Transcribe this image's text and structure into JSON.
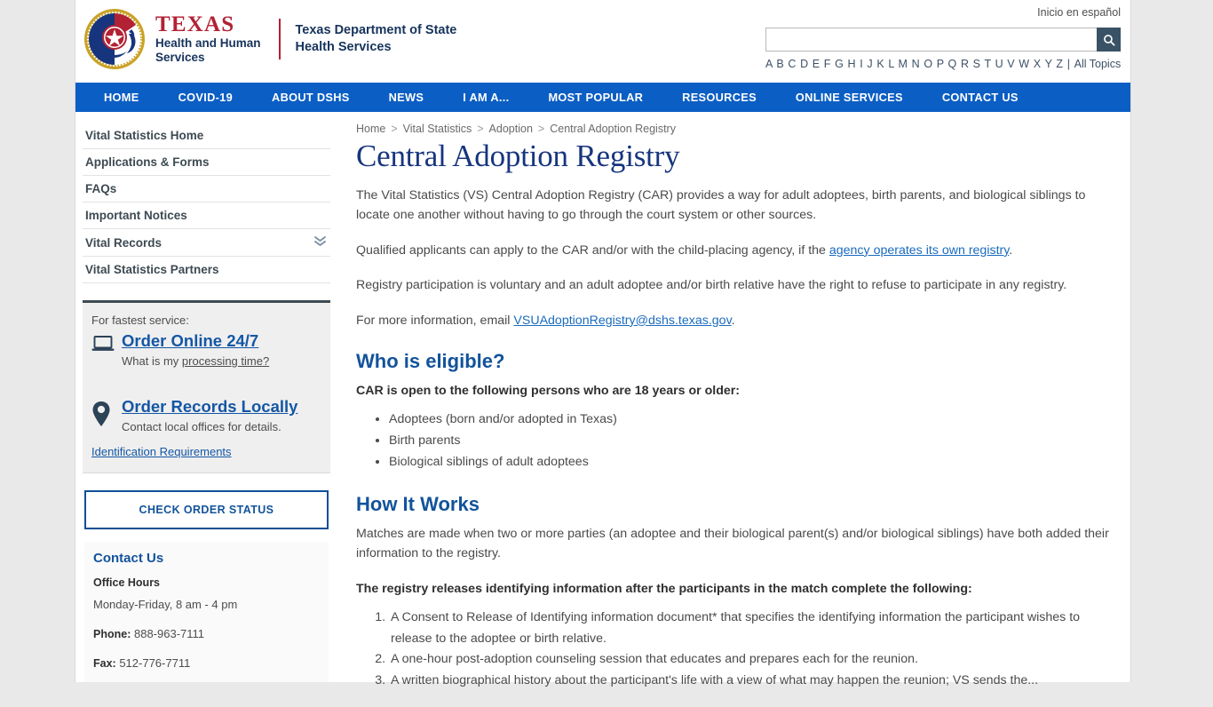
{
  "header": {
    "brand_texas": "TEXAS",
    "brand_hhs_line1": "Health and Human",
    "brand_hhs_line2": "Services",
    "brand_dshs_line1": "Texas Department of State",
    "brand_dshs_line2": "Health Services",
    "espanol_link": "Inicio en español",
    "search_value": "",
    "search_placeholder": "",
    "search_icon": "search-icon",
    "alphabet": [
      "A",
      "B",
      "C",
      "D",
      "E",
      "F",
      "G",
      "H",
      "I",
      "J",
      "K",
      "L",
      "M",
      "N",
      "O",
      "P",
      "Q",
      "R",
      "S",
      "T",
      "U",
      "V",
      "W",
      "X",
      "Y",
      "Z"
    ],
    "alphabet_separator": "|",
    "all_topics": "All Topics"
  },
  "nav": {
    "items": [
      {
        "label": "HOME"
      },
      {
        "label": "COVID-19"
      },
      {
        "label": "ABOUT DSHS"
      },
      {
        "label": "NEWS"
      },
      {
        "label": "I AM A..."
      },
      {
        "label": "MOST POPULAR"
      },
      {
        "label": "RESOURCES"
      },
      {
        "label": "ONLINE SERVICES"
      },
      {
        "label": "CONTACT US"
      }
    ]
  },
  "sidebar": {
    "items": [
      {
        "label": "Vital Statistics Home",
        "chevron": false
      },
      {
        "label": "Applications & Forms",
        "chevron": false
      },
      {
        "label": "FAQs",
        "chevron": false
      },
      {
        "label": "Important Notices",
        "chevron": false
      },
      {
        "label": "Vital Records",
        "chevron": true
      },
      {
        "label": "Vital Statistics Partners",
        "chevron": false
      }
    ],
    "service_box": {
      "lead": "For fastest service:",
      "online_label": "Order Online 24/7",
      "online_sub_prefix": "What is my ",
      "online_sub_link": "processing time?",
      "local_label": "Order Records Locally",
      "local_sub": "Contact local offices for details.",
      "id_requirements": "Identification Requirements"
    },
    "check_order_status": "CHECK ORDER STATUS",
    "contact": {
      "heading": "Contact Us",
      "office_hours_label": "Office Hours",
      "office_hours_value": "Monday-Friday, 8 am - 4 pm",
      "phone_label": "Phone:",
      "phone_value": "888-963-7111",
      "fax_label": "Fax:",
      "fax_value": "512-776-7711"
    }
  },
  "main": {
    "breadcrumb": [
      "Home",
      "Vital Statistics",
      "Adoption",
      "Central Adoption Registry"
    ],
    "breadcrumb_separator": ">",
    "title": "Central Adoption Registry",
    "intro_p1": "The Vital Statistics (VS) Central Adoption Registry (CAR) provides a way for adult adoptees, birth parents, and biological siblings to locate one another without having to go through the court system or other sources.",
    "p2_before": "Qualified applicants can apply to the CAR and/or with the child-placing agency, if the ",
    "p2_link": "agency operates its own registry",
    "p2_after": ".",
    "p3": "Registry participation is voluntary and an adult adoptee and/or birth relative have the right to refuse to participate in any registry.",
    "p4_before": "For more information, email ",
    "p4_link": "VSUAdoptionRegistry@dshs.texas.gov",
    "p4_after": ".",
    "eligible_heading": "Who is eligible?",
    "eligible_lead": "CAR is open to the following persons who are 18 years or older:",
    "eligible_items": [
      "Adoptees (born and/or adopted in Texas)",
      "Birth parents",
      "Biological siblings of adult adoptees"
    ],
    "how_heading": "How It Works",
    "how_p1": "Matches are made when two or more parties (an adoptee and their biological parent(s) and/or biological siblings) have both added their information to the registry.",
    "how_lead": "The registry releases identifying information after the participants in the match complete the following:",
    "how_items": [
      "A Consent to Release of Identifying information document* that specifies the identifying information the participant wishes to release to the adoptee or birth relative.",
      "A one-hour post-adoption counseling session that educates and prepares each for the reunion.",
      "A written biographical history about the participant's life with a view of what may happen the reunion; VS sends the..."
    ]
  },
  "colors": {
    "nav_blue": "#0b5ec4",
    "brand_navy": "#17345c",
    "brand_red": "#b22234",
    "link_blue": "#1457a5",
    "heading_blue": "#12539b",
    "title_navy": "#17357e",
    "page_bg": "#e9e9e9"
  }
}
